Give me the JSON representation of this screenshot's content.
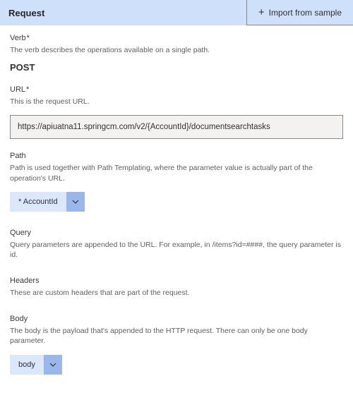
{
  "header": {
    "title": "Request",
    "import_label": "Import from sample"
  },
  "verb": {
    "label": "Verb",
    "required_marker": "*",
    "description": "The verb describes the operations available on a single path.",
    "value": "POST"
  },
  "url": {
    "label": "URL",
    "required_marker": "*",
    "description": "This is the request URL.",
    "value": "https://apiuatna11.springcm.com/v2/{AccountId}/documentsearchtasks"
  },
  "path": {
    "label": "Path",
    "description": "Path is used together with Path Templating, where the parameter value is actually part of the operation's URL.",
    "dropdown": {
      "label": "* AccountId"
    }
  },
  "query": {
    "label": "Query",
    "description": "Query parameters are appended to the URL. For example, in /items?id=####, the query parameter is id."
  },
  "headers": {
    "label": "Headers",
    "description": "These are custom headers that are part of the request."
  },
  "bodysec": {
    "label": "Body",
    "description": "The body is the payload that's appended to the HTTP request. There can only be one body parameter.",
    "dropdown": {
      "label": "body"
    }
  }
}
